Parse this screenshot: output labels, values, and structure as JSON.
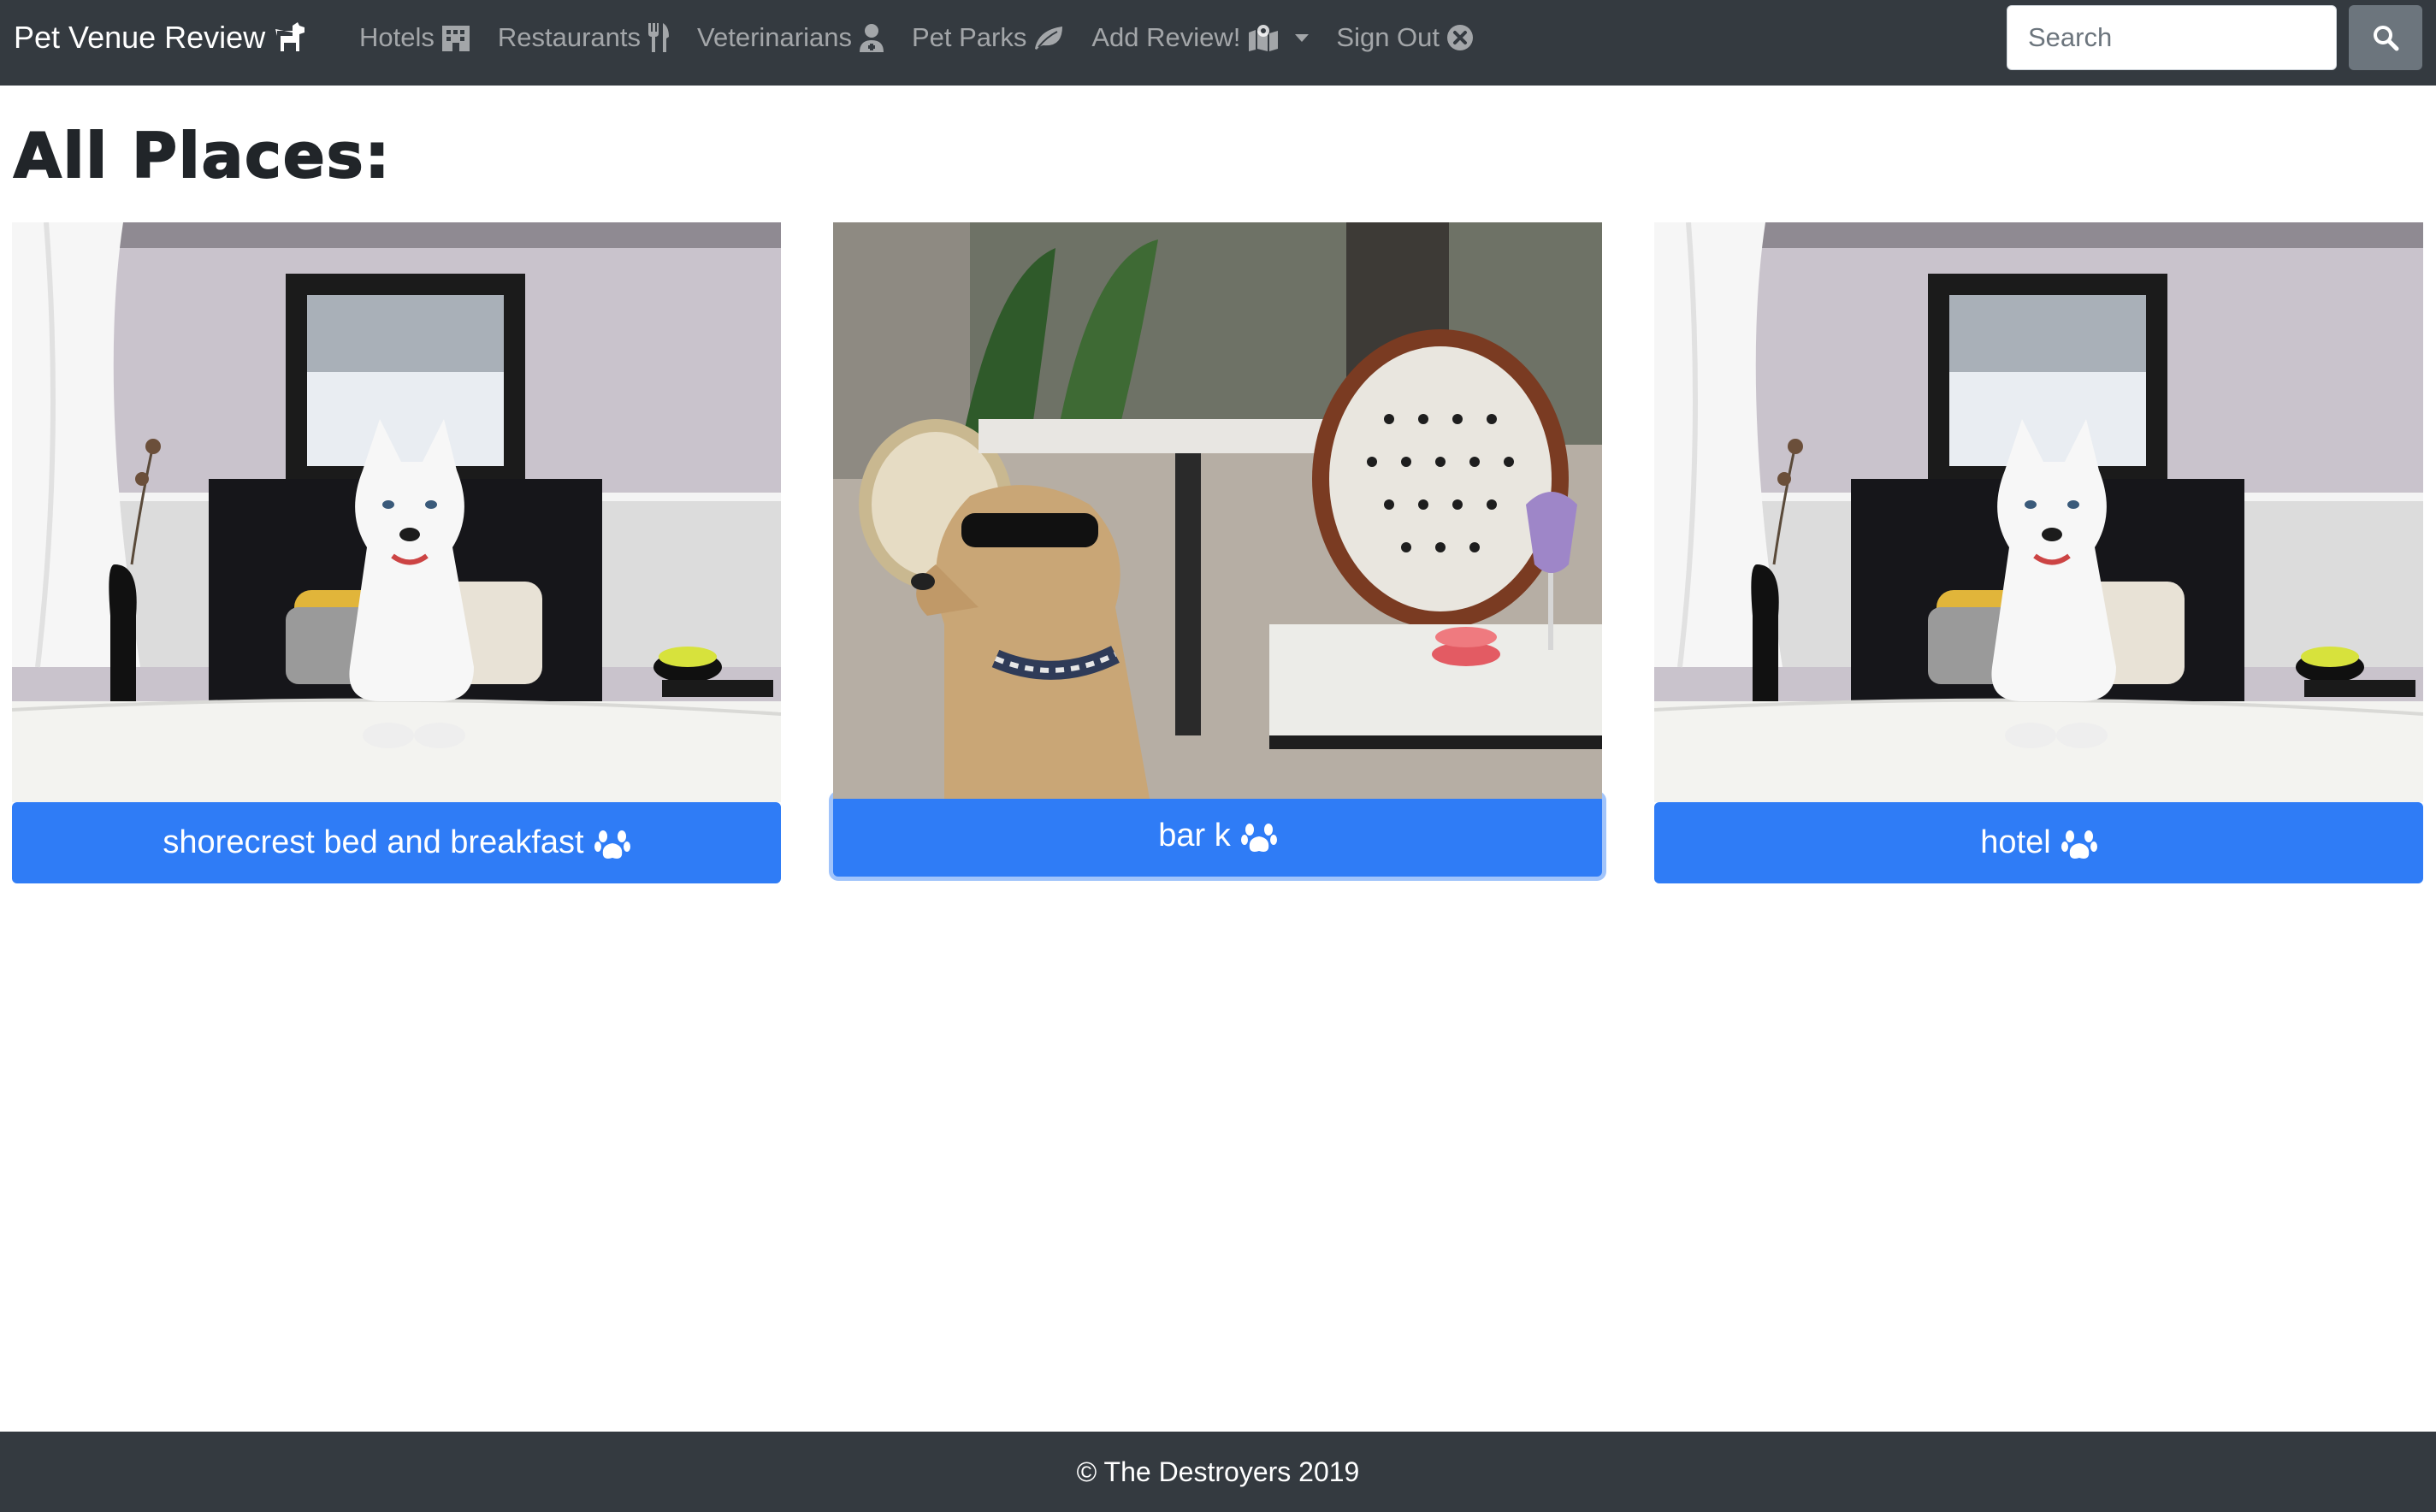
{
  "navbar": {
    "brand": "Pet Venue Review",
    "brand_icon": "dog-icon",
    "items": [
      {
        "label": "Hotels",
        "icon": "hotel-icon"
      },
      {
        "label": "Restaurants",
        "icon": "utensils-icon"
      },
      {
        "label": "Veterinarians",
        "icon": "user-md-icon"
      },
      {
        "label": "Pet Parks",
        "icon": "leaf-icon"
      },
      {
        "label": "Add Review!",
        "icon": "map-marked-icon"
      },
      {
        "label": "Sign Out",
        "icon": "times-circle-icon"
      }
    ],
    "search_placeholder": "Search",
    "search_button_icon": "search-icon"
  },
  "page": {
    "title": "All Places:"
  },
  "cards": [
    {
      "label": "shorecrest bed and breakfast",
      "icon": "paw-icon",
      "image": "husky on hotel bed"
    },
    {
      "label": "bar k",
      "icon": "paw-icon",
      "image": "dog with sunglasses at cafe"
    },
    {
      "label": "hotel",
      "icon": "paw-icon",
      "image": "husky on hotel bed"
    }
  ],
  "footer": {
    "text": "© The Destroyers 2019"
  },
  "colors": {
    "navbar_bg": "#343a40",
    "card_button": "#2f7cf6",
    "search_button": "#6c757d"
  }
}
